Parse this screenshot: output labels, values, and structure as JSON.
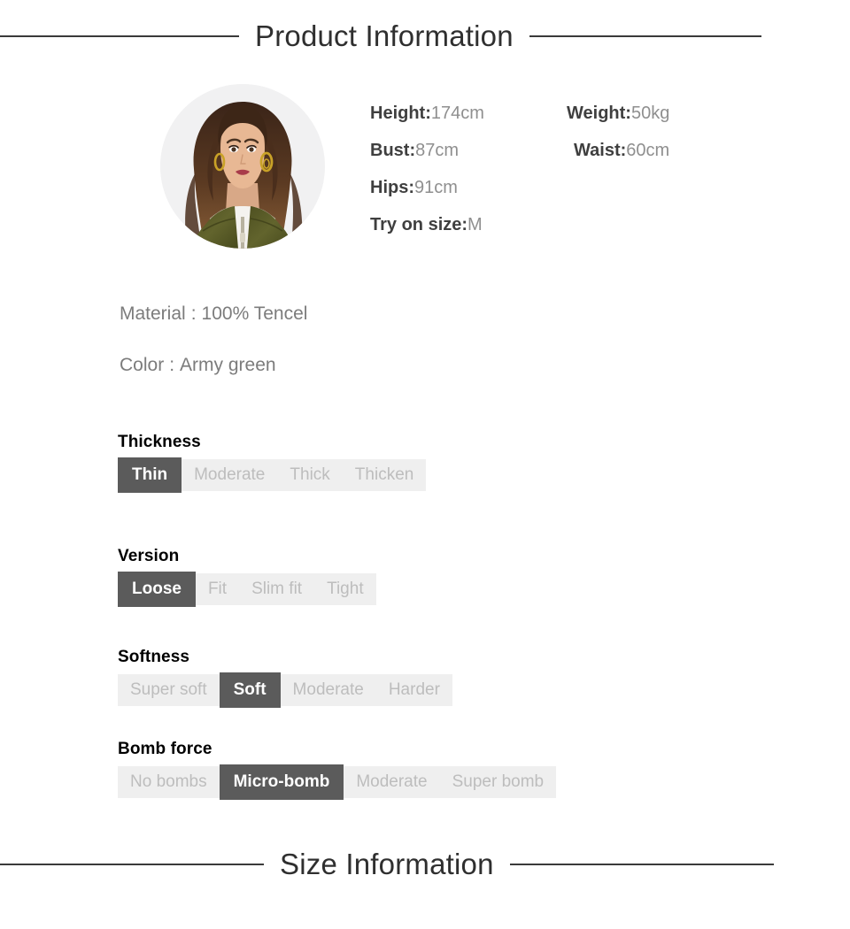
{
  "headers": {
    "product": "Product Information",
    "size": "Size Information"
  },
  "model": {
    "photo_alt": "model-wearing-army-green-jacket",
    "measurements": [
      [
        {
          "label": "Height:",
          "value": "174cm"
        },
        {
          "label": "Weight:",
          "value": "50kg"
        }
      ],
      [
        {
          "label": "Bust:",
          "value": "87cm"
        },
        {
          "label": "Waist:",
          "value": "60cm"
        }
      ],
      [
        {
          "label": "Hips:",
          "value": "91cm"
        },
        {
          "label": "",
          "value": ""
        }
      ],
      [
        {
          "label": "Try on size:",
          "value": "M"
        },
        {
          "label": "",
          "value": ""
        }
      ]
    ]
  },
  "specs": [
    {
      "label": "Material",
      "sep": ":",
      "value": "100% Tencel"
    },
    {
      "label": "Color",
      "sep": ":",
      "value": "Army green"
    }
  ],
  "attributes": [
    {
      "label": "Thickness",
      "options": [
        "Thin",
        "Moderate",
        "Thick",
        "Thicken"
      ],
      "selected": "Thin"
    },
    {
      "label": "Version",
      "options": [
        "Loose",
        "Fit",
        "Slim fit",
        "Tight"
      ],
      "selected": "Loose"
    },
    {
      "label": "Softness",
      "options": [
        "Super soft",
        "Soft",
        "Moderate",
        "Harder"
      ],
      "selected": "Soft"
    },
    {
      "label": "Bomb force",
      "options": [
        "No bombs",
        "Micro-bomb",
        "Moderate",
        "Super bomb"
      ],
      "selected": "Micro-bomb"
    }
  ],
  "colors": {
    "selected_chip_bg": "#5b5b5b",
    "selected_chip_text": "#ffffff",
    "bar_bg": "#efefef",
    "unselected_text": "#bdbdbd",
    "rule": "#3a3a3a",
    "garment": "#5a5c27"
  }
}
